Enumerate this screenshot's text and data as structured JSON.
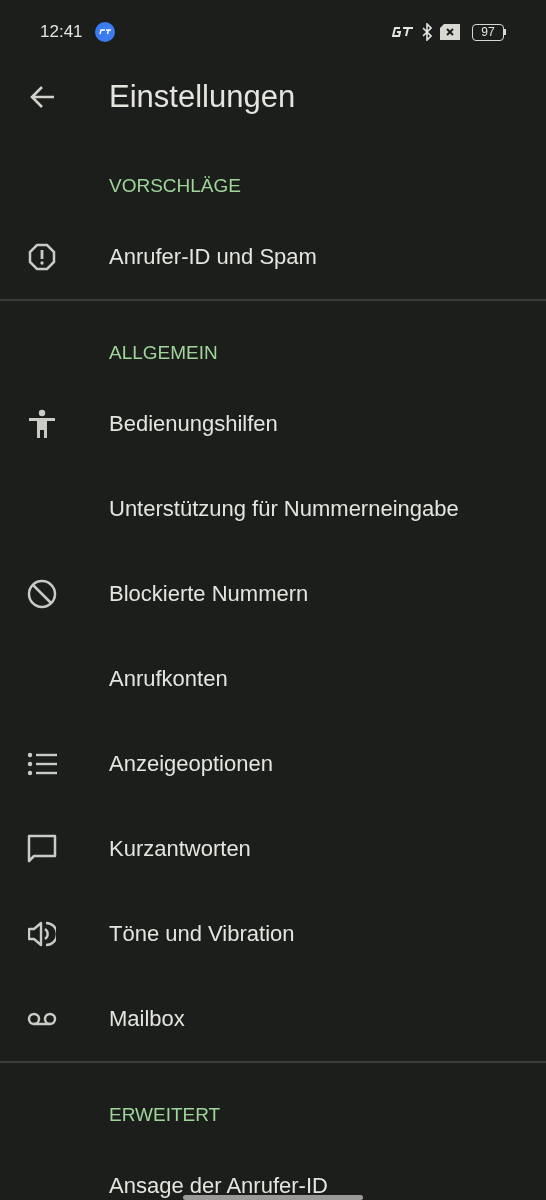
{
  "status_bar": {
    "time": "12:41",
    "battery": "97"
  },
  "header": {
    "title": "Einstellungen"
  },
  "sections": [
    {
      "title": "VORSCHLÄGE",
      "items": [
        {
          "label": "Anrufer-ID und Spam",
          "kind": "alert"
        }
      ]
    },
    {
      "title": "ALLGEMEIN",
      "items": [
        {
          "label": "Bedienungshilfen",
          "kind": "accessibility"
        },
        {
          "label": "Unterstützung für Nummerneingabe",
          "kind": "plain"
        },
        {
          "label": "Blockierte Nummern",
          "kind": "blocked"
        },
        {
          "label": "Anrufkonten",
          "kind": "plain"
        },
        {
          "label": "Anzeigeoptionen",
          "kind": "list"
        },
        {
          "label": "Kurzantworten",
          "kind": "message"
        },
        {
          "label": "Töne und Vibration",
          "kind": "sound"
        },
        {
          "label": "Mailbox",
          "kind": "voicemail"
        }
      ]
    },
    {
      "title": "ERWEITERT",
      "items": [
        {
          "label": "Ansage der Anrufer-ID",
          "kind": "plain"
        }
      ]
    }
  ]
}
